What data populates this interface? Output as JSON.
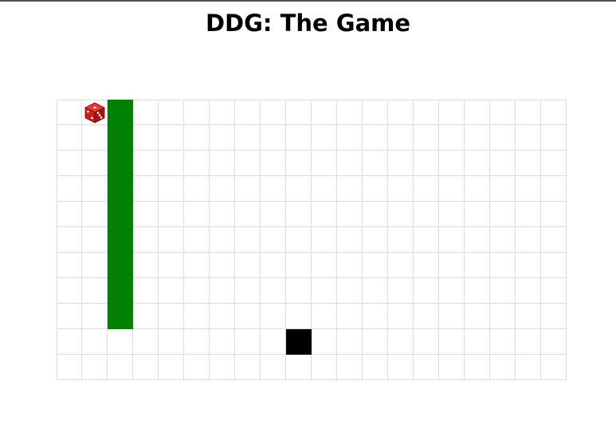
{
  "title": "DDG: The Game",
  "board": {
    "columns": 20,
    "rows": 11,
    "grid_color": "#dcdcdc"
  },
  "snake": {
    "color": "#008000",
    "segments": [
      {
        "col": 2,
        "row": 0
      },
      {
        "col": 2,
        "row": 1
      },
      {
        "col": 2,
        "row": 2
      },
      {
        "col": 2,
        "row": 3
      },
      {
        "col": 2,
        "row": 4
      },
      {
        "col": 2,
        "row": 5
      },
      {
        "col": 2,
        "row": 6
      },
      {
        "col": 2,
        "row": 7
      },
      {
        "col": 2,
        "row": 8
      }
    ]
  },
  "food": {
    "color": "#000000",
    "col": 9,
    "row": 9
  },
  "dice": {
    "icon": "dice-icon",
    "color": "#cc1f1f",
    "col": 1,
    "row": 0
  }
}
